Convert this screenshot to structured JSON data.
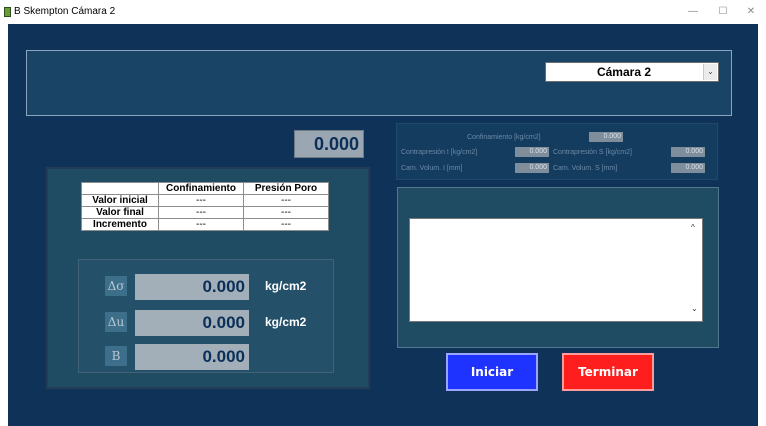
{
  "window": {
    "title": "B Skempton Cámara 2",
    "minimize_glyph": "—",
    "maximize_glyph": "☐",
    "close_glyph": "✕"
  },
  "chamber_select": {
    "value": "Cámara 2",
    "arrow_glyph": "⌄"
  },
  "main_readout": "0.000",
  "table": {
    "headers": [
      "",
      "Confinamiento",
      "Presión Poro"
    ],
    "rows": [
      {
        "label": "Valor inicial",
        "confinamiento": "---",
        "presion": "---"
      },
      {
        "label": "Valor final",
        "confinamiento": "---",
        "presion": "---"
      },
      {
        "label": "Incremento",
        "confinamiento": "---",
        "presion": "---"
      }
    ]
  },
  "measurements": [
    {
      "symbol": "Δσ",
      "value": "0.000",
      "unit": "kg/cm2"
    },
    {
      "symbol": "Δu",
      "value": "0.000",
      "unit": "kg/cm2"
    },
    {
      "symbol": "B",
      "value": "0.000",
      "unit": ""
    }
  ],
  "status": {
    "confinamiento_label": "Confinamiento [kg/cm2]",
    "confinamiento_value": "0.000",
    "contrapresion_i_label": "Contrapresión I [kg/cm2]",
    "contrapresion_i_value": "0.000",
    "contrapresion_s_label": "Contrapresión S [kg/cm2]",
    "contrapresion_s_value": "0.000",
    "cam_volum_i_label": "Cam. Volum. I [mm]",
    "cam_volum_i_value": "0.000",
    "cam_volum_s_label": "Cam. Volum. S [mm]",
    "cam_volum_s_value": "0.000"
  },
  "log_text": "",
  "buttons": {
    "start": "Iniciar",
    "stop": "Terminar"
  },
  "colors": {
    "background": "#0f3358",
    "start_button": "#1e33ff",
    "stop_button": "#ff1e1e"
  }
}
